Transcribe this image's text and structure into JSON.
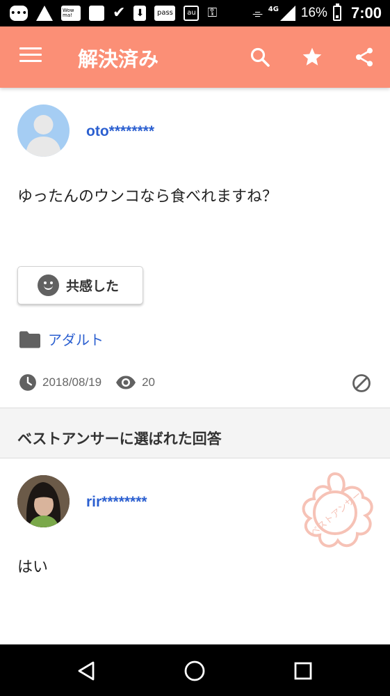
{
  "status_bar": {
    "icons": [
      "message-icon",
      "warning-icon",
      "wowma-icon",
      "image-icon",
      "check-icon",
      "download-icon",
      "pass-icon",
      "au-icon",
      "key-icon",
      "nfc-icon",
      "signal-icon"
    ],
    "wowma_label": "Wow ma!",
    "pass_label": "pass",
    "au_label": "au",
    "network": "4G",
    "battery": "16%",
    "time": "7:00"
  },
  "app_bar": {
    "title": "解決済み",
    "background": "#fb8f76"
  },
  "question": {
    "username": "oto********",
    "text": "ゆったんのウンコなら食べれますね？",
    "empathy_label": "共感した",
    "category": "アダルト",
    "date": "2018/08/19",
    "views": "20"
  },
  "best_answer_section": {
    "title": "ベストアンサーに選ばれた回答"
  },
  "answer": {
    "username": "rir********",
    "text": "はい",
    "stamp_text": "ベストアンサー"
  },
  "colors": {
    "accent": "#fb8f76",
    "link": "#2b5fd0",
    "stamp": "#f6c2b6"
  }
}
